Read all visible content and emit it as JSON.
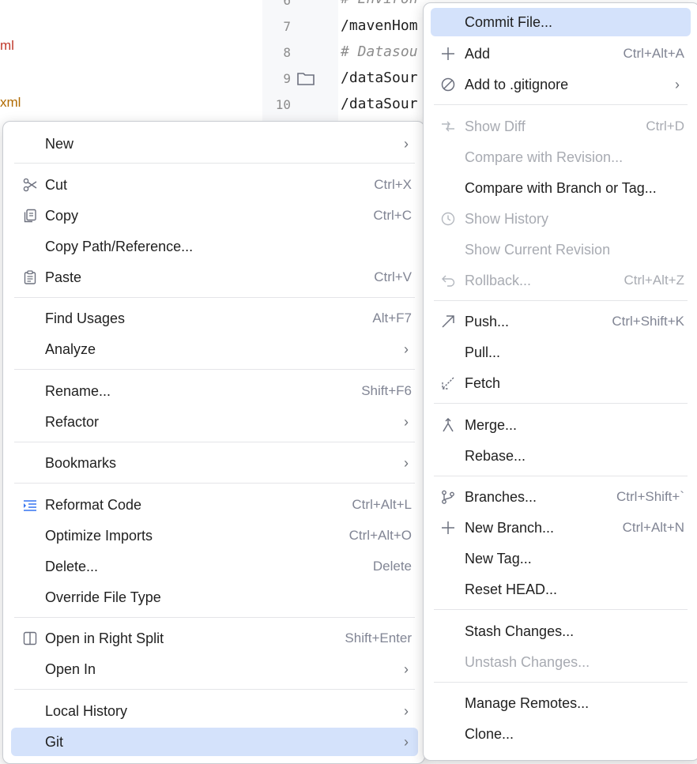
{
  "project_tree": {
    "items": [
      {
        "label": "ml",
        "color": "#c0392b"
      },
      {
        "label": "xml",
        "color": "#b06a00"
      }
    ]
  },
  "editor": {
    "lines": [
      {
        "number": "6",
        "text": "# Environ",
        "kind": "comment"
      },
      {
        "number": "7",
        "text": "/mavenHom",
        "kind": "code"
      },
      {
        "number": "8",
        "text": "# Datasou",
        "kind": "comment"
      },
      {
        "number": "9",
        "text": "/dataSour",
        "kind": "code"
      },
      {
        "number": "10",
        "text": "/dataSour",
        "kind": "code"
      }
    ]
  },
  "context_menu": {
    "items": [
      {
        "label": "New",
        "shortcut": "",
        "submenu": true,
        "mnemonic": "N"
      },
      {
        "label": "Cut",
        "shortcut": "Ctrl+X",
        "icon": "scissors-icon"
      },
      {
        "label": "Copy",
        "shortcut": "Ctrl+C",
        "icon": "copy-icon"
      },
      {
        "label": "Copy Path/Reference...",
        "shortcut": ""
      },
      {
        "label": "Paste",
        "shortcut": "Ctrl+V",
        "icon": "clipboard-icon"
      },
      {
        "label": "Find Usages",
        "shortcut": "Alt+F7"
      },
      {
        "label": "Analyze",
        "shortcut": "",
        "submenu": true
      },
      {
        "label": "Rename...",
        "shortcut": "Shift+F6"
      },
      {
        "label": "Refactor",
        "shortcut": "",
        "submenu": true
      },
      {
        "label": "Bookmarks",
        "shortcut": "",
        "submenu": true
      },
      {
        "label": "Reformat Code",
        "shortcut": "Ctrl+Alt+L",
        "icon": "reformat-icon"
      },
      {
        "label": "Optimize Imports",
        "shortcut": "Ctrl+Alt+O"
      },
      {
        "label": "Delete...",
        "shortcut": "Delete"
      },
      {
        "label": "Override File Type",
        "shortcut": ""
      },
      {
        "label": "Open in Right Split",
        "shortcut": "Shift+Enter",
        "icon": "split-icon"
      },
      {
        "label": "Open In",
        "shortcut": "",
        "submenu": true
      },
      {
        "label": "Local History",
        "shortcut": "",
        "submenu": true
      },
      {
        "label": "Git",
        "shortcut": "",
        "submenu": true,
        "highlighted": true
      }
    ]
  },
  "git_menu": {
    "items": [
      {
        "label": "Commit File...",
        "shortcut": "",
        "highlighted": true
      },
      {
        "label": "Add",
        "shortcut": "Ctrl+Alt+A",
        "icon": "plus-icon"
      },
      {
        "label": "Add to .gitignore",
        "shortcut": "",
        "submenu": true,
        "icon": "ignore-icon"
      },
      {
        "label": "Show Diff",
        "shortcut": "Ctrl+D",
        "disabled": true,
        "icon": "diff-icon"
      },
      {
        "label": "Compare with Revision...",
        "shortcut": "",
        "disabled": true
      },
      {
        "label": "Compare with Branch or Tag...",
        "shortcut": ""
      },
      {
        "label": "Show History",
        "shortcut": "",
        "disabled": true,
        "icon": "history-icon"
      },
      {
        "label": "Show Current Revision",
        "shortcut": "",
        "disabled": true
      },
      {
        "label": "Rollback...",
        "shortcut": "Ctrl+Alt+Z",
        "disabled": true,
        "icon": "rollback-icon"
      },
      {
        "label": "Push...",
        "shortcut": "Ctrl+Shift+K",
        "icon": "push-icon"
      },
      {
        "label": "Pull...",
        "shortcut": ""
      },
      {
        "label": "Fetch",
        "shortcut": "",
        "icon": "fetch-icon"
      },
      {
        "label": "Merge...",
        "shortcut": "",
        "icon": "merge-icon"
      },
      {
        "label": "Rebase...",
        "shortcut": ""
      },
      {
        "label": "Branches...",
        "shortcut": "Ctrl+Shift+`",
        "icon": "branch-icon"
      },
      {
        "label": "New Branch...",
        "shortcut": "Ctrl+Alt+N",
        "icon": "plus-icon"
      },
      {
        "label": "New Tag...",
        "shortcut": ""
      },
      {
        "label": "Reset HEAD...",
        "shortcut": ""
      },
      {
        "label": "Stash Changes...",
        "shortcut": ""
      },
      {
        "label": "Unstash Changes...",
        "shortcut": "",
        "disabled": true
      },
      {
        "label": "Manage Remotes...",
        "shortcut": ""
      },
      {
        "label": "Clone...",
        "shortcut": ""
      }
    ]
  },
  "colors": {
    "highlight": "#d4e2fb",
    "disabled_text": "#a8abb2",
    "shortcut_text": "#818594",
    "separator": "#e4e5e8"
  }
}
